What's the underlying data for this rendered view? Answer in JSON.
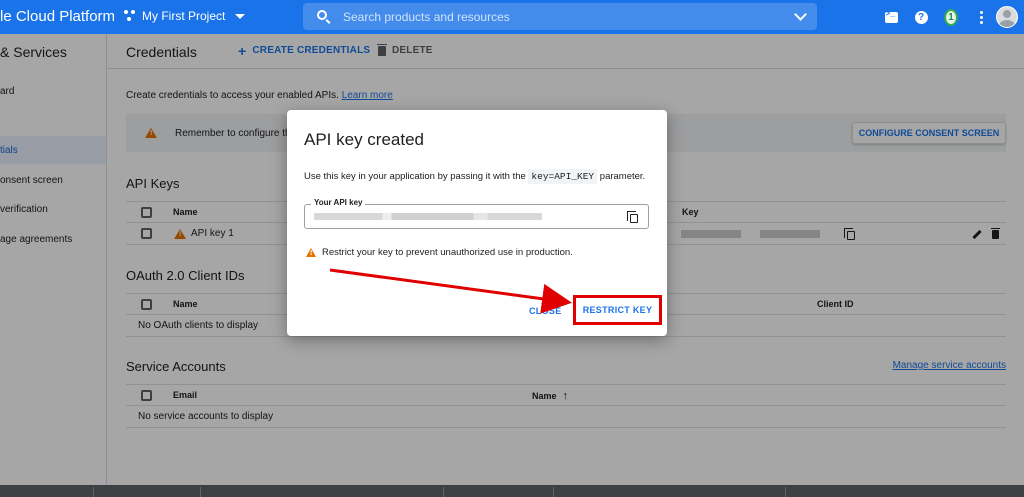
{
  "topbar": {
    "brand": "le Cloud Platform",
    "project": "My First Project",
    "search_placeholder": "Search products and resources",
    "notifications": "1"
  },
  "sidebar": {
    "title": "& Services",
    "items": [
      {
        "label": "ard"
      },
      {
        "label": "tials"
      },
      {
        "label": "onsent screen"
      },
      {
        "label": " verification"
      },
      {
        "label": "age agreements"
      }
    ]
  },
  "main": {
    "title": "Credentials",
    "create_label": "CREATE CREDENTIALS",
    "delete_label": "DELETE",
    "intro_text": "Create credentials to access your enabled APIs.",
    "learn_more": "Learn more",
    "banner_text": "Remember to configure th",
    "consent_button": "CONFIGURE CONSENT SCREEN",
    "api_keys": {
      "title": "API Keys",
      "col_name": "Name",
      "col_key": "Key",
      "rows": [
        {
          "name": "API key 1"
        }
      ]
    },
    "oauth": {
      "title": "OAuth 2.0 Client IDs",
      "col_name": "Name",
      "col_client": "Client ID",
      "empty": "No OAuth clients to display"
    },
    "service": {
      "title": "Service Accounts",
      "manage_link": "Manage service accounts",
      "col_email": "Email",
      "col_name": "Name",
      "empty": "No service accounts to display"
    }
  },
  "dialog": {
    "title": "API key created",
    "desc_pre": "Use this key in your application by passing it with the",
    "desc_code": "key=API_KEY",
    "desc_post": "parameter.",
    "key_label": "Your API key",
    "warning": "Restrict your key to prevent unauthorized use in production.",
    "close": "CLOSE",
    "restrict": "RESTRICT KEY"
  },
  "colors": {
    "brand_blue": "#1a73e8",
    "highlight_red": "#e00000",
    "warning_orange": "#e37400"
  }
}
